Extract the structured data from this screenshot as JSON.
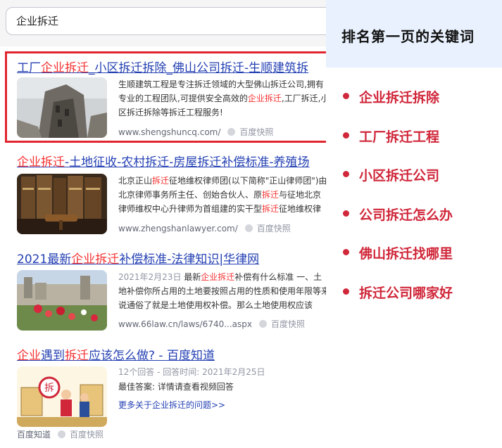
{
  "search": {
    "query": "企业拆迁"
  },
  "results": [
    {
      "title_parts": [
        {
          "text": "工厂",
          "hl": false
        },
        {
          "text": "企业拆迁",
          "hl": true
        },
        {
          "text": "_小区拆迁拆除_佛山公司拆迁-生顺建筑拆",
          "hl": false
        }
      ],
      "abstract_parts": [
        {
          "text": "生顺建筑工程是专注拆迁领域的大型佛山拆迁公司,拥有专业的工程团队,可提供安全高效的",
          "cls": ""
        },
        {
          "text": "企业拆迁",
          "cls": "hl"
        },
        {
          "text": ",工厂拆迁,小区拆迁拆除等拆迁工程服务!",
          "cls": ""
        }
      ],
      "url": "www.shengshuncq.com/",
      "cache": "百度快照",
      "thumb": "demolition-site-image"
    },
    {
      "title_parts": [
        {
          "text": "企业拆迁",
          "hl": true
        },
        {
          "text": "-土地征收-农村拆迁-房屋拆迁补偿标准-养殖场",
          "hl": false
        }
      ],
      "abstract_parts": [
        {
          "text": "北京正山",
          "cls": ""
        },
        {
          "text": "拆迁",
          "cls": "hl"
        },
        {
          "text": "征地维权律师团(以下简称\"正山律师团\")由北京律师事务所主任、创始合伙人、原",
          "cls": ""
        },
        {
          "text": "拆迁",
          "cls": "hl"
        },
        {
          "text": "与征地北京律师维权中心升律师为首组建的实干型",
          "cls": ""
        },
        {
          "text": "拆迁",
          "cls": "hl"
        },
        {
          "text": "征地维权律师联盟。",
          "cls": ""
        }
      ],
      "url": "www.zhengshanlawyer.com/",
      "cache": "百度快照",
      "thumb": "law-books-gavel-image"
    },
    {
      "title_parts": [
        {
          "text": "2021最新",
          "hl": false
        },
        {
          "text": "企业拆迁",
          "hl": true
        },
        {
          "text": "补偿标准-法律知识|华律网",
          "hl": false
        }
      ],
      "abstract_parts": [
        {
          "text": "2021年2月23日 ",
          "cls": "date"
        },
        {
          "text": "最新",
          "cls": ""
        },
        {
          "text": "企业拆迁",
          "cls": "hl"
        },
        {
          "text": "补偿有什么标准 一、土地补偿你所占用的土地要按照占用的性质和使用年限等来说通俗了就是土地使用权补偿。那么土地使用权应该",
          "cls": ""
        }
      ],
      "url": "www.66law.cn/laws/6740...aspx",
      "cache": "百度快照",
      "thumb": "village-flowers-image"
    },
    {
      "title_parts": [
        {
          "text": "企业",
          "hl": true
        },
        {
          "text": "遇到",
          "hl": false
        },
        {
          "text": "拆迁",
          "hl": true
        },
        {
          "text": "应该怎么做? - 百度知道",
          "hl": false
        }
      ],
      "meta": "12个回答 - 回答时间: 2021年2月25日",
      "best_answer": "最佳答案: 详情请查看视频回答",
      "more_link": "更多关于企业拆迁的问题>>",
      "url": "百度知道",
      "cache": "百度快照",
      "thumb": "cartoon-demolition-image"
    }
  ],
  "panel": {
    "title": "排名第一页的关键词",
    "keywords": [
      "企业拆迁拆除",
      "工厂拆迁工程",
      "小区拆迁公司",
      "公司拆迁怎么办",
      "佛山拆迁找哪里",
      "拆迁公司哪家好"
    ],
    "accent": "#d0273a",
    "header_bg": "#e8f1fd"
  }
}
